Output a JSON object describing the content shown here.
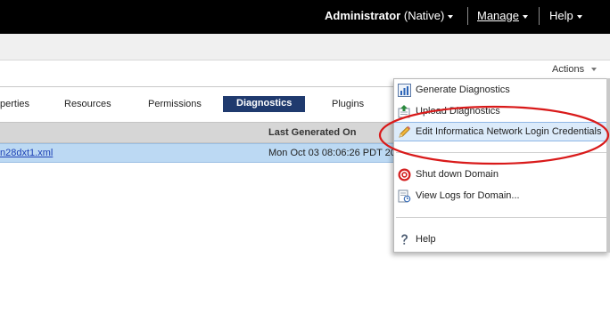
{
  "header": {
    "user_name": "Administrator",
    "user_domain": "(Native)",
    "manage_label": "Manage",
    "help_label": "Help"
  },
  "toolbar": {
    "actions_label": "Actions"
  },
  "tabs": [
    {
      "label": "perties"
    },
    {
      "label": "Resources"
    },
    {
      "label": "Permissions"
    },
    {
      "label": "Diagnostics",
      "active": true
    },
    {
      "label": "Plugins"
    }
  ],
  "table": {
    "column_header": "Last Generated On",
    "row": {
      "file": "n28dxt1.xml",
      "date": "Mon Oct 03 08:06:26 PDT 20"
    }
  },
  "dropdown": {
    "items": [
      {
        "label": "Generate Diagnostics",
        "icon": "chart-icon"
      },
      {
        "label": "Upload Diagnostics",
        "icon": "upload-icon"
      },
      {
        "label": "Edit Informatica Network Login Credentials",
        "icon": "pencil-icon",
        "highlighted": true
      },
      {
        "label": "Shut down Domain",
        "icon": "shutdown-icon"
      },
      {
        "label": "View Logs for Domain...",
        "icon": "logs-icon"
      },
      {
        "label": "Help",
        "icon": "help-icon"
      }
    ]
  },
  "colors": {
    "topbar": "#000000",
    "active_tab": "#1f3a6e",
    "selected_row": "#bcd9f3",
    "annotation": "#d91a1a"
  }
}
